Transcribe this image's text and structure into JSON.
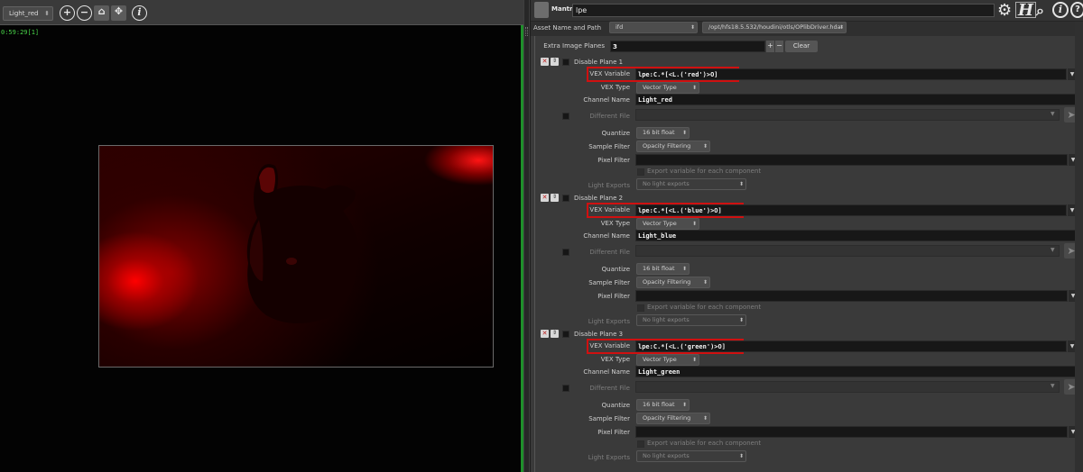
{
  "viewer": {
    "camera_select": "Light_red",
    "timecode": "0:59:29[1]",
    "zoom_in_icon": "zoom-in-icon",
    "zoom_out_icon": "zoom-out-icon",
    "home_icon": "home-icon",
    "pan_icon": "move-icon",
    "info_icon": "info-icon"
  },
  "header": {
    "node_type": "Mantra",
    "node_name": "lpe"
  },
  "asset": {
    "label": "Asset Name and Path",
    "ifd": "ifd",
    "path": "/opt/hfs18.5.532/houdini/otls/OPlibDriver.hda"
  },
  "extra": {
    "label": "Extra Image Planes",
    "value": "3",
    "clear": "Clear"
  },
  "labels": {
    "vex_variable": "VEX Variable",
    "vex_type": "VEX Type",
    "channel_name": "Channel Name",
    "different_file": "Different File",
    "quantize": "Quantize",
    "sample_filter": "Sample Filter",
    "pixel_filter": "Pixel Filter",
    "export_each": "Export variable for each component",
    "light_exports": "Light Exports"
  },
  "planes": [
    {
      "title": "Disable Plane 1",
      "vex": "lpe:C.*[<L.('red')>O]",
      "type": "Vector Type",
      "channel": "Light_red",
      "quantize": "16 bit float",
      "sample_filter": "Opacity Filtering",
      "light_exports": "No light exports"
    },
    {
      "title": "Disable Plane 2",
      "vex": "lpe:C.*[<L.('blue')>O]",
      "type": "Vector Type",
      "channel": "Light_blue",
      "quantize": "16 bit float",
      "sample_filter": "Opacity Filtering",
      "light_exports": "No light exports"
    },
    {
      "title": "Disable Plane 3",
      "vex": "lpe:C.*[<L.('green')>O]",
      "type": "Vector Type",
      "channel": "Light_green",
      "quantize": "16 bit float",
      "sample_filter": "Opacity Filtering",
      "light_exports": "No light exports"
    }
  ]
}
